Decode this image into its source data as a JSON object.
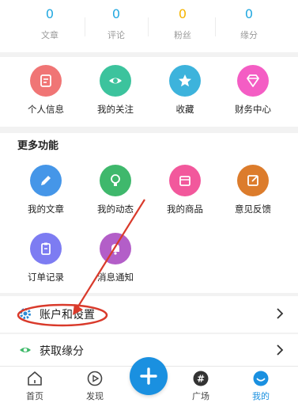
{
  "stats": [
    {
      "value": "0",
      "label": "文章"
    },
    {
      "value": "0",
      "label": "评论"
    },
    {
      "value": "0",
      "label": "粉丝"
    },
    {
      "value": "0",
      "label": "缘分"
    }
  ],
  "stat_colors": [
    "#22a8e0",
    "#22a8e0",
    "#f5b400",
    "#22a8e0"
  ],
  "quick_actions": [
    {
      "label": "个人信息",
      "icon": "profile-card-icon",
      "color": "#f07575"
    },
    {
      "label": "我的关注",
      "icon": "eye-icon",
      "color": "#3cc39d"
    },
    {
      "label": "收藏",
      "icon": "star-icon",
      "color": "#3db3dc"
    },
    {
      "label": "财务中心",
      "icon": "diamond-icon",
      "color": "#f45dc4"
    }
  ],
  "more": {
    "title": "更多功能",
    "items": [
      {
        "label": "我的文章",
        "icon": "pencil-icon",
        "color": "#4596e8"
      },
      {
        "label": "我的动态",
        "icon": "lightbulb-icon",
        "color": "#3fb86c"
      },
      {
        "label": "我的商品",
        "icon": "shop-icon",
        "color": "#f2589c"
      },
      {
        "label": "意见反馈",
        "icon": "edit-note-icon",
        "color": "#dc7c2c"
      },
      {
        "label": "订单记录",
        "icon": "clipboard-icon",
        "color": "#7d7cf2"
      },
      {
        "label": "消息通知",
        "icon": "bell-icon",
        "color": "#b35ec8"
      }
    ]
  },
  "rows": [
    {
      "label": "账户和设置",
      "icon": "gear-icon"
    },
    {
      "label": "获取缘分",
      "icon": "eye-icon"
    }
  ],
  "tabs": [
    {
      "label": "首页",
      "icon": "home-icon"
    },
    {
      "label": "发现",
      "icon": "play-circle-icon"
    },
    {
      "label": "广场",
      "icon": "hashtag-icon"
    },
    {
      "label": "我的",
      "icon": "smile-icon",
      "active": true
    }
  ],
  "colors": {
    "accent": "#1a90e0",
    "annotation": "#d93a2b"
  }
}
